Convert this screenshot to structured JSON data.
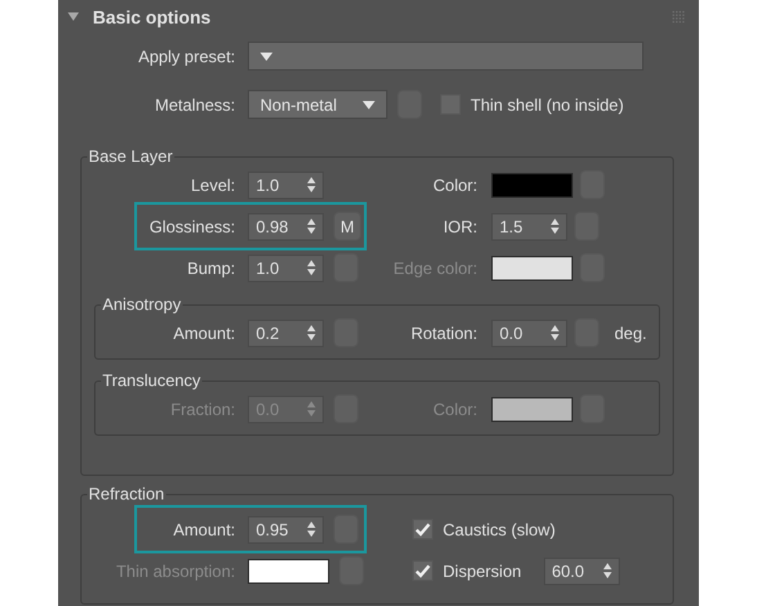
{
  "panel": {
    "title": "Basic options",
    "expanded": true
  },
  "top_rows": [
    {
      "label": "Apply preset:",
      "controls": [
        {
          "kind": "dropdown"
        }
      ]
    },
    {
      "label": "Metalness:",
      "controls": [
        {
          "kind": "dropdown",
          "value": "Non-metal"
        },
        {
          "kind": "map"
        },
        {
          "kind": "checkbox",
          "checked": false,
          "label": "Thin shell (no inside)"
        }
      ]
    }
  ],
  "groups": [
    {
      "title": "Base Layer",
      "rows": [
        {
          "label": "Level:",
          "controls": [
            {
              "kind": "spinner",
              "value": "1.0"
            }
          ],
          "right": {
            "label": "Color:",
            "controls": [
              {
                "kind": "swatch",
                "color": "#000000"
              },
              {
                "kind": "map"
              }
            ]
          }
        },
        {
          "label": "Glossiness:",
          "highlighted": true,
          "controls": [
            {
              "kind": "spinner",
              "value": "0.98"
            },
            {
              "kind": "map",
              "text": "M"
            }
          ],
          "right": {
            "label": "IOR:",
            "controls": [
              {
                "kind": "spinner",
                "value": "1.5"
              },
              {
                "kind": "map"
              }
            ]
          }
        },
        {
          "label": "Bump:",
          "controls": [
            {
              "kind": "spinner",
              "value": "1.0"
            },
            {
              "kind": "map"
            }
          ],
          "right": {
            "label": "Edge color:",
            "disabled": true,
            "controls": [
              {
                "kind": "swatch",
                "color": "#e1e1e1"
              },
              {
                "kind": "map"
              }
            ]
          }
        }
      ],
      "subgroups": [
        {
          "title": "Anisotropy",
          "rows": [
            {
              "label": "Amount:",
              "controls": [
                {
                  "kind": "spinner",
                  "value": "0.2"
                },
                {
                  "kind": "map"
                }
              ],
              "right": {
                "label": "Rotation:",
                "controls": [
                  {
                    "kind": "spinner",
                    "value": "0.0"
                  },
                  {
                    "kind": "map"
                  },
                  {
                    "kind": "unit",
                    "text": "deg."
                  }
                ]
              }
            }
          ]
        },
        {
          "title": "Translucency",
          "rows": [
            {
              "label": "Fraction:",
              "disabled": true,
              "controls": [
                {
                  "kind": "spinner",
                  "value": "0.0",
                  "disabled": true
                },
                {
                  "kind": "map"
                }
              ],
              "right": {
                "label": "Color:",
                "disabled": true,
                "controls": [
                  {
                    "kind": "swatch",
                    "color": "#b9b9b9"
                  },
                  {
                    "kind": "map"
                  }
                ]
              }
            }
          ]
        }
      ]
    },
    {
      "title": "Refraction",
      "rows": [
        {
          "label": "Amount:",
          "highlighted": true,
          "controls": [
            {
              "kind": "spinner",
              "value": "0.95"
            },
            {
              "kind": "map"
            }
          ],
          "right": {
            "controls": [
              {
                "kind": "checkbox",
                "checked": true,
                "label": "Caustics (slow)"
              }
            ]
          }
        },
        {
          "label": "Thin absorption:",
          "disabled": true,
          "controls": [
            {
              "kind": "swatch",
              "color": "#ffffff"
            },
            {
              "kind": "map"
            }
          ],
          "right": {
            "controls": [
              {
                "kind": "checkbox",
                "checked": true,
                "label": "Dispersion"
              },
              {
                "kind": "spinner",
                "value": "60.0"
              }
            ]
          }
        }
      ]
    }
  ]
}
